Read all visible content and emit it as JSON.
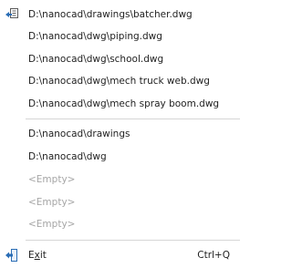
{
  "recent_files": [
    "D:\\nanocad\\drawings\\batcher.dwg",
    "D:\\nanocad\\dwg\\piping.dwg",
    "D:\\nanocad\\dwg\\school.dwg",
    "D:\\nanocad\\dwg\\mech truck web.dwg",
    "D:\\nanocad\\dwg\\mech spray boom.dwg"
  ],
  "recent_folders": [
    "D:\\nanocad\\drawings",
    "D:\\nanocad\\dwg"
  ],
  "empty_slots": [
    "<Empty>",
    "<Empty>",
    "<Empty>"
  ],
  "exit": {
    "label_mnemonic": "x",
    "label_prefix": "E",
    "label_suffix": "it",
    "shortcut": "Ctrl+Q"
  },
  "icons": {
    "first_file": "recent-file-icon",
    "exit": "exit-icon"
  },
  "colors": {
    "text": "#1f1f1f",
    "disabled_text": "#a6a6a6",
    "separator": "#d6d6d6",
    "icon_blue": "#2a6db5"
  }
}
